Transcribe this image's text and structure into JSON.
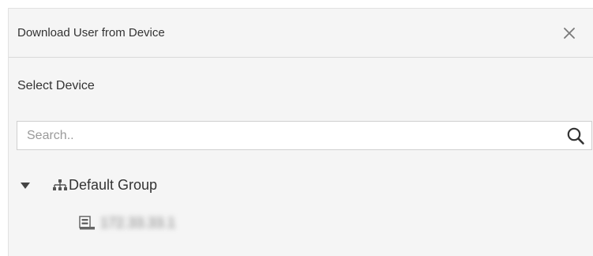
{
  "dialog": {
    "title": "Download User from Device",
    "close_icon": "close-icon"
  },
  "section": {
    "label": "Select Device"
  },
  "search": {
    "placeholder": "Search..",
    "value": "",
    "icon": "search-icon"
  },
  "tree": {
    "group": {
      "label": "Default Group",
      "expanded": true,
      "expander_icon": "triangle-down-icon",
      "icon": "org-tree-icon"
    },
    "devices": [
      {
        "label": "172.33.33.1",
        "icon": "device-icon"
      }
    ]
  },
  "colors": {
    "dialog_background": "#f5f5f5",
    "text": "#333333",
    "placeholder": "#9a9a9a",
    "divider": "#d9d9d9"
  }
}
